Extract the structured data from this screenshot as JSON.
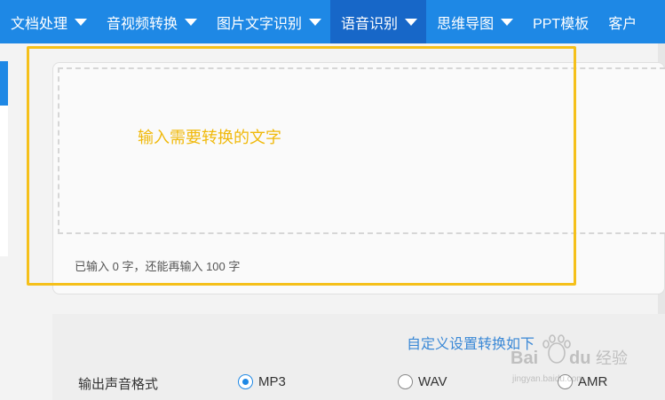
{
  "nav": {
    "items": [
      {
        "label": "文档处理",
        "caret": true
      },
      {
        "label": "音视频转换",
        "caret": true
      },
      {
        "label": "图片文字识别",
        "caret": true
      },
      {
        "label": "语音识别",
        "caret": true,
        "active": true
      },
      {
        "label": "思维导图",
        "caret": true
      },
      {
        "label": "PPT模板",
        "caret": false
      },
      {
        "label": "客户",
        "caret": false
      }
    ]
  },
  "editor": {
    "placeholder": "输入需要转换的文字",
    "char_count_text": "已输入 0 字，还能再输入 100 字"
  },
  "settings": {
    "heading": "自定义设置转换如下",
    "format_label": "输出声音格式",
    "formats": [
      {
        "label": "MP3",
        "checked": true
      },
      {
        "label": "WAV",
        "checked": false
      },
      {
        "label": "AMR",
        "checked": false
      }
    ]
  },
  "watermark": {
    "text": "Bai du 经验",
    "subtext": "jingyan.baidu.com"
  },
  "colors": {
    "nav_bg": "#1e88e5",
    "nav_active": "#1767c8",
    "placeholder_text": "#f0b90b",
    "highlight_border": "#f5c01a",
    "link_blue": "#3a88d6"
  }
}
